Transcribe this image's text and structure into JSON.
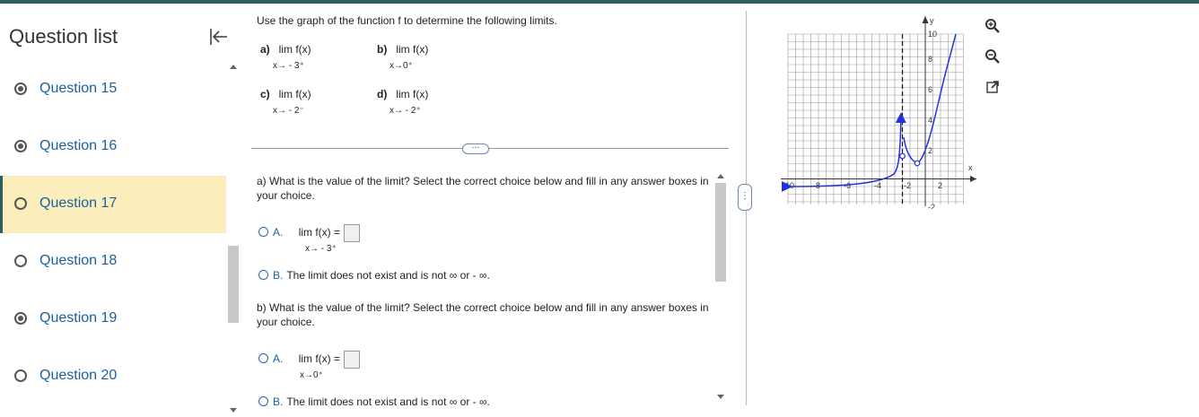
{
  "sidebar": {
    "title": "Question list",
    "questions": [
      {
        "label": "Question 15",
        "status": "filled"
      },
      {
        "label": "Question 16",
        "status": "filled"
      },
      {
        "label": "Question 17",
        "status": "empty",
        "active": true
      },
      {
        "label": "Question 18",
        "status": "empty"
      },
      {
        "label": "Question 19",
        "status": "filled"
      },
      {
        "label": "Question 20",
        "status": "empty"
      }
    ],
    "collapse_icon": "collapse-left-icon"
  },
  "problem": {
    "prompt": "Use the graph of the function f to determine the following limits.",
    "parts": [
      {
        "tag": "a)",
        "expr": "lim  f(x)",
        "sub": "x→ - 3⁺"
      },
      {
        "tag": "b)",
        "expr": "lim  f(x)",
        "sub": "x→0⁺"
      },
      {
        "tag": "c)",
        "expr": "lim  f(x)",
        "sub": "x→ - 2⁻"
      },
      {
        "tag": "d)",
        "expr": "lim  f(x)",
        "sub": "x→ - 2⁺"
      }
    ],
    "expand_label": "⋯"
  },
  "part_a": {
    "question": "a) What is the value of the limit? Select the correct choice below and fill in any answer boxes in your choice.",
    "choice_a_label": "A.",
    "choice_a_expr": "lim  f(x) =",
    "choice_a_sub": "x→ - 3⁺",
    "choice_b_label": "B.",
    "choice_b_text": "The limit does not exist and is not ∞ or  - ∞."
  },
  "part_b": {
    "question": "b) What is the value of the limit? Select the correct choice below and fill in any answer boxes in your choice.",
    "choice_a_label": "A.",
    "choice_a_expr": "lim  f(x) =",
    "choice_a_sub": "x→0⁺",
    "choice_b_label": "B.",
    "choice_b_text": "The limit does not exist and is not ∞ or  - ∞."
  },
  "graph": {
    "x_ticks": [
      "-10",
      "-8",
      "-6",
      "-4",
      "-2",
      "2"
    ],
    "y_ticks": [
      "10",
      "8",
      "6",
      "4",
      "2",
      "-2"
    ],
    "x_axis_label": "x",
    "y_axis_label": "y",
    "curve_color": "#2233dd"
  },
  "tools": [
    "zoom-in-icon",
    "zoom-out-icon",
    "external-link-icon"
  ]
}
